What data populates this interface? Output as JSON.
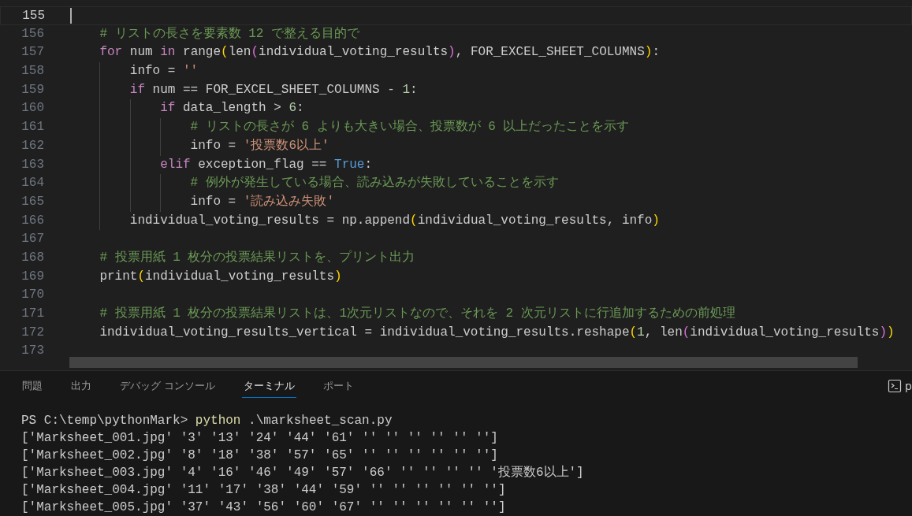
{
  "editor": {
    "lines": [
      {
        "number": "155",
        "active": true
      },
      {
        "number": "156",
        "active": false,
        "tokens": [
          {
            "kind": "comment",
            "t": "    # リストの長さを要素数 12 で整える目的で"
          }
        ]
      },
      {
        "number": "157",
        "active": false,
        "tokens": [
          {
            "kind": "keyword",
            "t": "    for"
          },
          {
            "kind": "plain",
            "t": " num "
          },
          {
            "kind": "keyword",
            "t": "in"
          },
          {
            "kind": "plain",
            "t": " range"
          },
          {
            "kind": "bracket1",
            "t": "("
          },
          {
            "kind": "plain",
            "t": "len"
          },
          {
            "kind": "bracket2",
            "t": "("
          },
          {
            "kind": "plain",
            "t": "individual_voting_results"
          },
          {
            "kind": "bracket2",
            "t": ")"
          },
          {
            "kind": "plain",
            "t": ", FOR_EXCEL_SHEET_COLUMNS"
          },
          {
            "kind": "bracket1",
            "t": ")"
          },
          {
            "kind": "plain",
            "t": ":"
          }
        ]
      },
      {
        "number": "158",
        "active": false,
        "tokens": [
          {
            "kind": "plain",
            "t": "        info = "
          },
          {
            "kind": "string",
            "t": "''"
          }
        ]
      },
      {
        "number": "159",
        "active": false,
        "tokens": [
          {
            "kind": "keyword",
            "t": "        if"
          },
          {
            "kind": "plain",
            "t": " num == FOR_EXCEL_SHEET_COLUMNS - "
          },
          {
            "kind": "number",
            "t": "1"
          },
          {
            "kind": "plain",
            "t": ":"
          }
        ]
      },
      {
        "number": "160",
        "active": false,
        "tokens": [
          {
            "kind": "keyword",
            "t": "            if"
          },
          {
            "kind": "plain",
            "t": " data_length > "
          },
          {
            "kind": "number",
            "t": "6"
          },
          {
            "kind": "plain",
            "t": ":"
          }
        ]
      },
      {
        "number": "161",
        "active": false,
        "tokens": [
          {
            "kind": "comment",
            "t": "                # リストの長さが 6 よりも大きい場合、投票数が 6 以上だったことを示す"
          }
        ]
      },
      {
        "number": "162",
        "active": false,
        "tokens": [
          {
            "kind": "plain",
            "t": "                info = "
          },
          {
            "kind": "string",
            "t": "'投票数6以上'"
          }
        ]
      },
      {
        "number": "163",
        "active": false,
        "tokens": [
          {
            "kind": "keyword",
            "t": "            elif"
          },
          {
            "kind": "plain",
            "t": " exception_flag == "
          },
          {
            "kind": "constant",
            "t": "True"
          },
          {
            "kind": "plain",
            "t": ":"
          }
        ]
      },
      {
        "number": "164",
        "active": false,
        "tokens": [
          {
            "kind": "comment",
            "t": "                # 例外が発生している場合、読み込みが失敗していることを示す"
          }
        ]
      },
      {
        "number": "165",
        "active": false,
        "tokens": [
          {
            "kind": "plain",
            "t": "                info = "
          },
          {
            "kind": "string",
            "t": "'読み込み失敗'"
          }
        ]
      },
      {
        "number": "166",
        "active": false,
        "tokens": [
          {
            "kind": "plain",
            "t": "        individual_voting_results = np.append"
          },
          {
            "kind": "bracket1",
            "t": "("
          },
          {
            "kind": "plain",
            "t": "individual_voting_results, info"
          },
          {
            "kind": "bracket1",
            "t": ")"
          }
        ]
      },
      {
        "number": "167",
        "active": false
      },
      {
        "number": "168",
        "active": false,
        "tokens": [
          {
            "kind": "comment",
            "t": "    # 投票用紙 1 枚分の投票結果リストを、プリント出力"
          }
        ]
      },
      {
        "number": "169",
        "active": false,
        "tokens": [
          {
            "kind": "plain",
            "t": "    print"
          },
          {
            "kind": "bracket1",
            "t": "("
          },
          {
            "kind": "plain",
            "t": "individual_voting_results"
          },
          {
            "kind": "bracket1",
            "t": ")"
          }
        ]
      },
      {
        "number": "170",
        "active": false
      },
      {
        "number": "171",
        "active": false,
        "tokens": [
          {
            "kind": "comment",
            "t": "    # 投票用紙 1 枚分の投票結果リストは、1次元リストなので、それを 2 次元リストに行追加するための前処理"
          }
        ]
      },
      {
        "number": "172",
        "active": false,
        "tokens": [
          {
            "kind": "plain",
            "t": "    individual_voting_results_vertical = individual_voting_results.reshape"
          },
          {
            "kind": "bracket1",
            "t": "("
          },
          {
            "kind": "number",
            "t": "1"
          },
          {
            "kind": "plain",
            "t": ", len"
          },
          {
            "kind": "bracket2",
            "t": "("
          },
          {
            "kind": "plain",
            "t": "individual_voting_results"
          },
          {
            "kind": "bracket2",
            "t": ")"
          },
          {
            "kind": "bracket1",
            "t": ")"
          }
        ]
      },
      {
        "number": "173",
        "active": false
      }
    ]
  },
  "panel": {
    "tabs": [
      {
        "label": "問題",
        "selected": false
      },
      {
        "label": "出力",
        "selected": false
      },
      {
        "label": "デバッグ コンソール",
        "selected": false
      },
      {
        "label": "ターミナル",
        "selected": true
      },
      {
        "label": "ポート",
        "selected": false
      }
    ],
    "terminal_tab": {
      "label": "p"
    },
    "terminal": {
      "lines": [
        {
          "kind": "prompt",
          "prompt": "PS C:\\temp\\pythonMark>",
          "command": "python",
          "args": ".\\marksheet_scan.py"
        },
        {
          "kind": "output",
          "text": "['Marksheet_001.jpg' '3' '13' '24' '44' '61' '' '' '' '' '' '']"
        },
        {
          "kind": "output",
          "text": "['Marksheet_002.jpg' '8' '18' '38' '57' '65' '' '' '' '' '' '']"
        },
        {
          "kind": "output",
          "text": "['Marksheet_003.jpg' '4' '16' '46' '49' '57' '66' '' '' '' '' '投票数6以上']"
        },
        {
          "kind": "output",
          "text": "['Marksheet_004.jpg' '11' '17' '38' '44' '59' '' '' '' '' '' '']"
        },
        {
          "kind": "output",
          "text": "['Marksheet_005.jpg' '37' '43' '56' '60' '67' '' '' '' '' '' '']"
        }
      ]
    }
  }
}
